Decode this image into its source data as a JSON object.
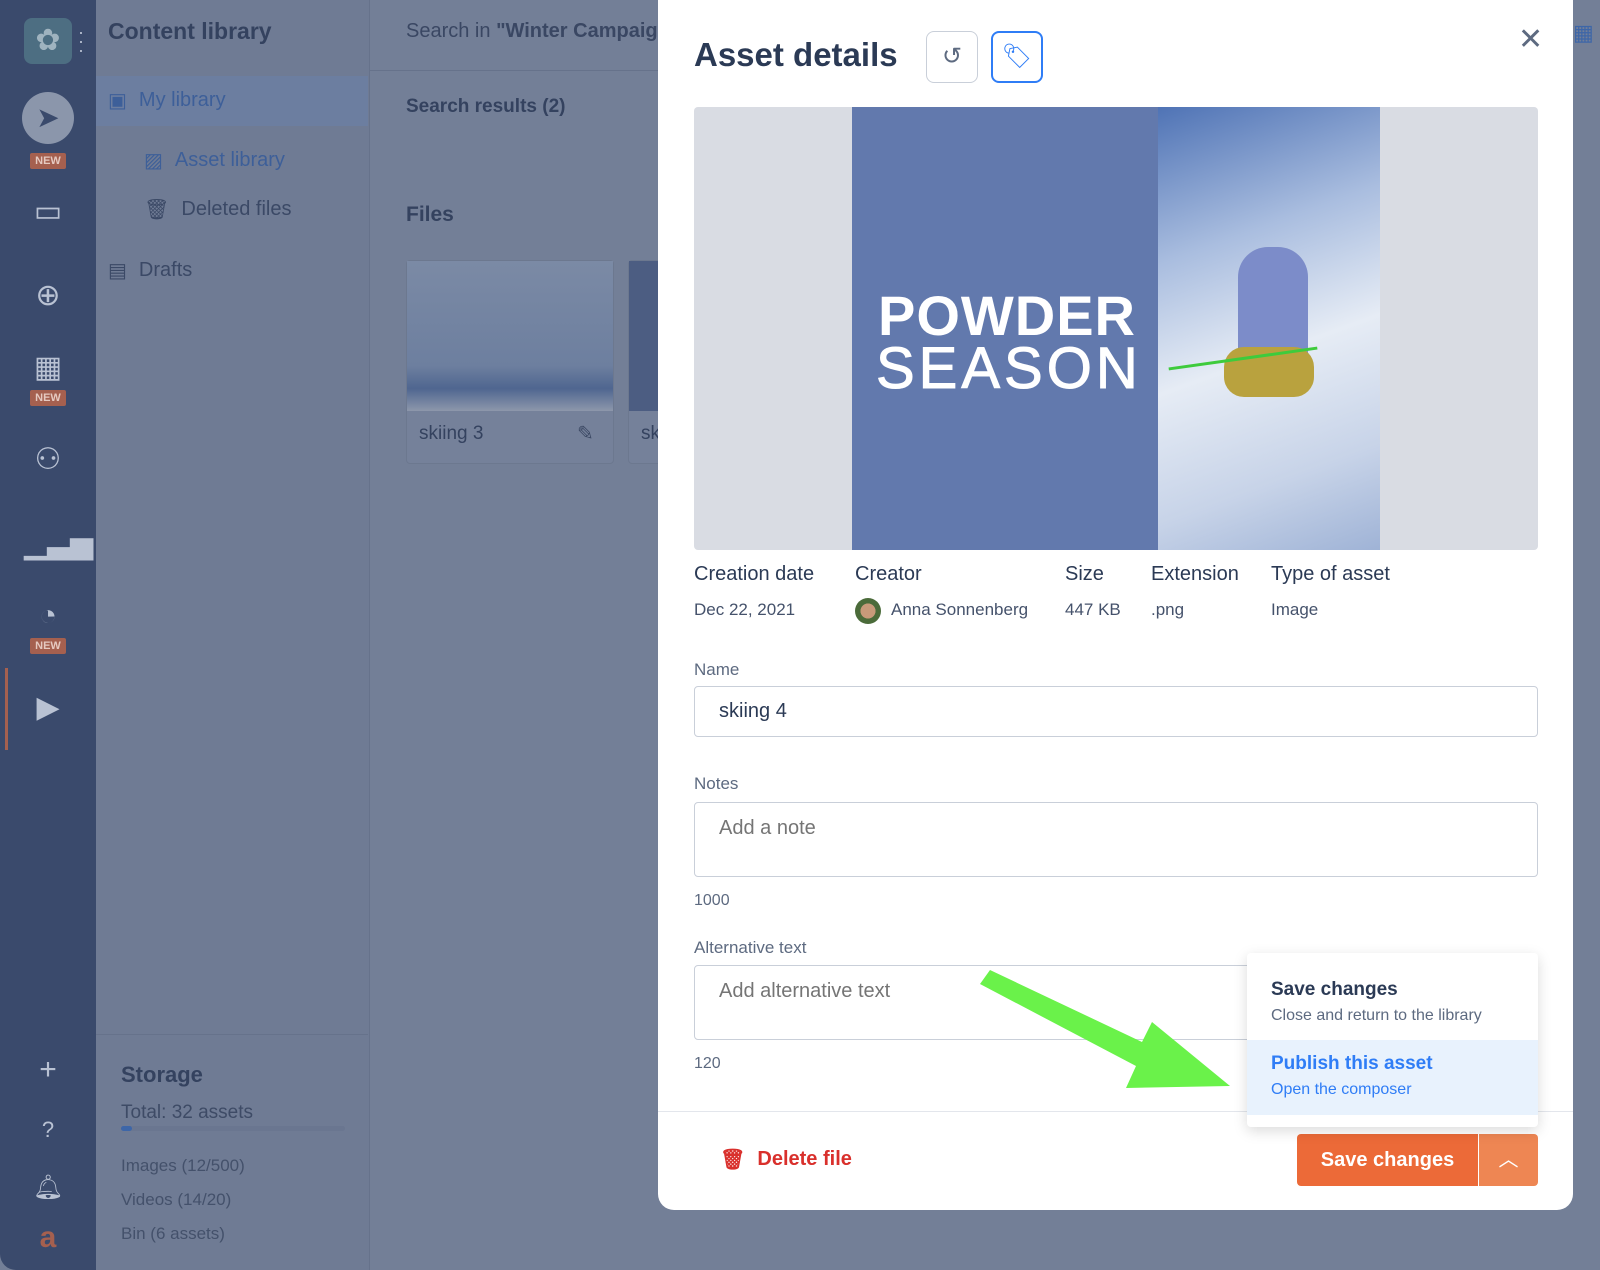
{
  "rail": {
    "badges": [
      "NEW",
      "NEW",
      "NEW"
    ]
  },
  "sidebar": {
    "title": "Content library",
    "items": [
      {
        "label": "My library",
        "icon": "media-folder-icon"
      },
      {
        "label": "Asset library",
        "icon": "image-icon"
      },
      {
        "label": "Deleted files",
        "icon": "trash-icon"
      },
      {
        "label": "Drafts",
        "icon": "notepad-icon"
      }
    ],
    "storage": {
      "title": "Storage",
      "total": "Total: 32 assets",
      "progress_fraction": 0.05,
      "lines": [
        "Images (12/500)",
        "Videos (14/20)",
        "Bin (6 assets)"
      ]
    }
  },
  "main": {
    "search_prefix": "Search in ",
    "search_term": "\"Winter Campaig",
    "results": "Search results (2)",
    "files_title": "Files",
    "files": [
      {
        "name": "skiing 3"
      },
      {
        "name": "sk"
      }
    ]
  },
  "modal": {
    "title": "Asset details",
    "poster": {
      "line1": "POWDER",
      "line2": "SEASON"
    },
    "meta": [
      {
        "label": "Creation date",
        "value": "Dec 22, 2021"
      },
      {
        "label": "Creator",
        "value": "Anna Sonnenberg"
      },
      {
        "label": "Size",
        "value": "447 KB"
      },
      {
        "label": "Extension",
        "value": ".png"
      },
      {
        "label": "Type of asset",
        "value": "Image"
      }
    ],
    "name_label": "Name",
    "name_value": "skiing 4",
    "notes_label": "Notes",
    "notes_placeholder": "Add a note",
    "notes_count": "1000",
    "alt_label": "Alternative text",
    "alt_placeholder": "Add alternative text",
    "alt_count": "120",
    "delete_label": "Delete file",
    "save_label": "Save changes",
    "dropdown": [
      {
        "title": "Save changes",
        "sub": "Close and return to the library"
      },
      {
        "title": "Publish this asset",
        "sub": "Open the composer"
      }
    ]
  },
  "colors": {
    "accent": "#2f7df6",
    "orange": "#ec6a38",
    "danger": "#d9302c",
    "arrow": "#6af24a"
  }
}
